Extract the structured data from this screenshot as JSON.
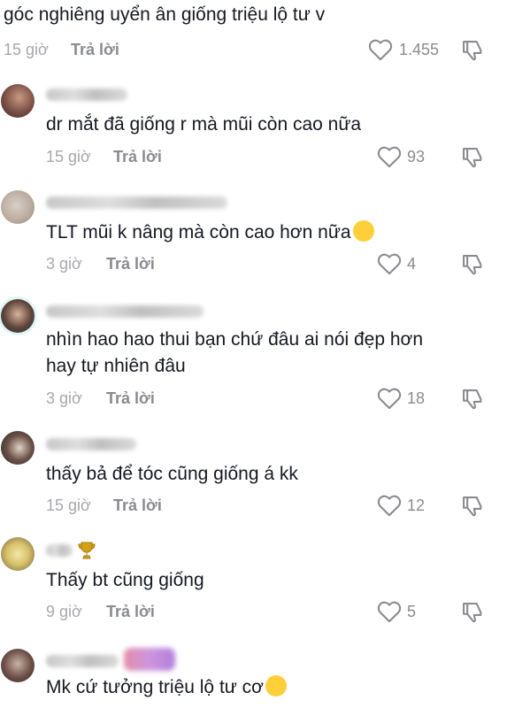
{
  "comments": [
    {
      "text": "góc nghiêng uyển ân giống triệu lộ tư v",
      "time": "15 giờ",
      "reply": "Trả lời",
      "likes": "1.455"
    },
    {
      "text": "dr mắt đã giống r mà mũi còn cao nữa",
      "time": "15 giờ",
      "reply": "Trả lời",
      "likes": "93"
    },
    {
      "text": "TLT mũi k nâng mà còn cao hơn nữa",
      "time": "3 giờ",
      "reply": "Trả lời",
      "likes": "4"
    },
    {
      "line1": "nhìn hao hao thui bạn chứ đâu ai nói đẹp hơn",
      "line2": "hay tự nhiên đâu",
      "time": "3 giờ",
      "reply": "Trả lời",
      "likes": "18"
    },
    {
      "text": "thấy bả để tóc cũng giống á kk",
      "time": "15 giờ",
      "reply": "Trả lời",
      "likes": "12"
    },
    {
      "text": "Thấy bt cũng giống",
      "time": "9 giờ",
      "reply": "Trả lời",
      "likes": "5"
    },
    {
      "text": "Mk cứ tưởng triệu lộ tư cơ",
      "time": "",
      "reply": "",
      "likes": ""
    }
  ]
}
